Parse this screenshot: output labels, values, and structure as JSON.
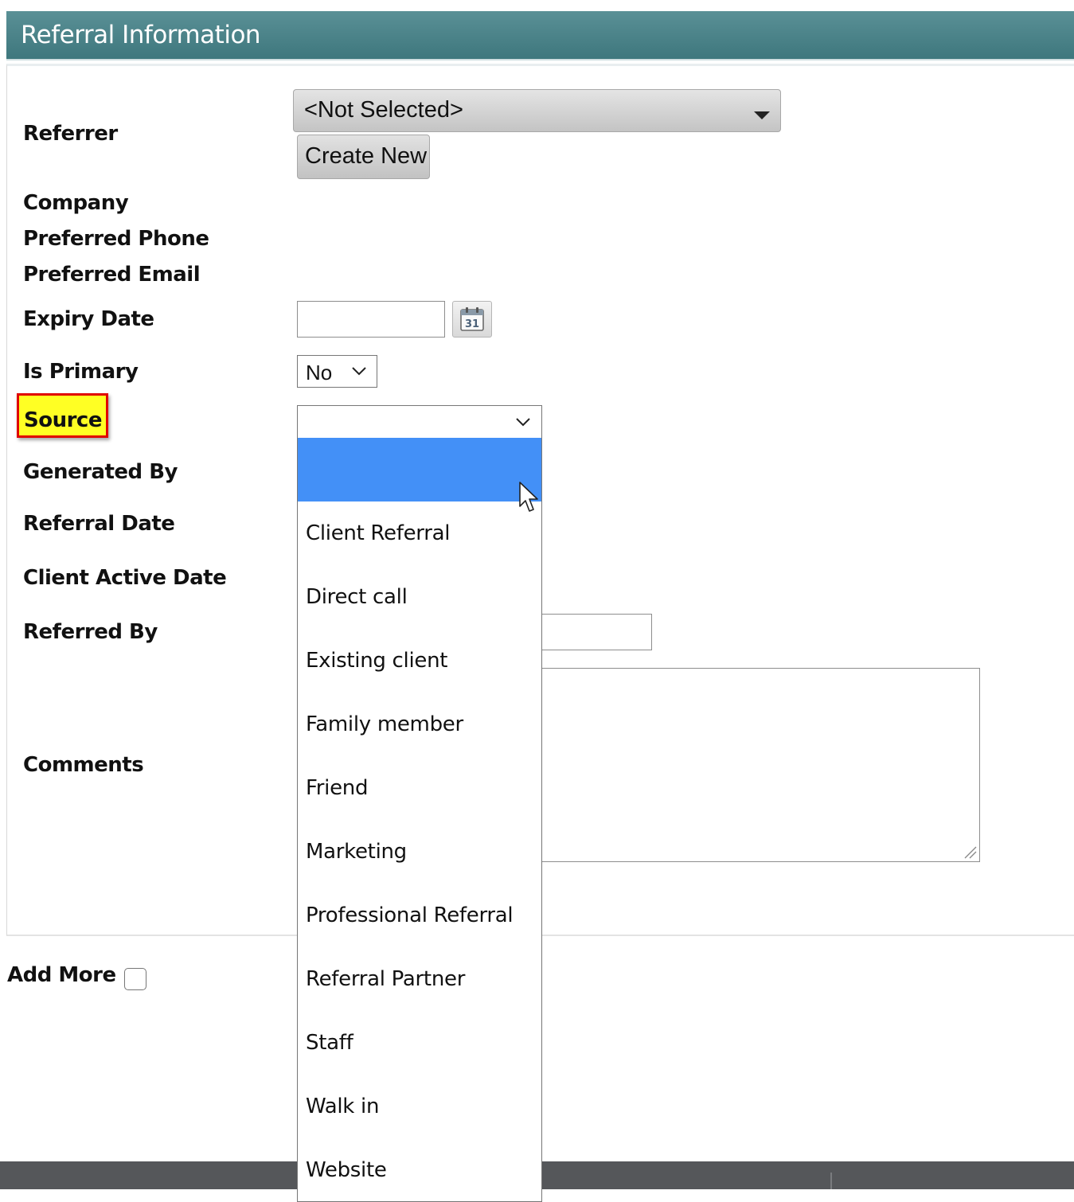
{
  "header": {
    "title": "Referral Information"
  },
  "labels": {
    "referrer": "Referrer",
    "company": "Company",
    "preferred_phone": "Preferred Phone",
    "preferred_email": "Preferred Email",
    "expiry_date": "Expiry Date",
    "is_primary": "Is Primary",
    "source": "Source",
    "generated_by": "Generated By",
    "referral_date": "Referral Date",
    "client_active_date": "Client Active Date",
    "referred_by": "Referred By",
    "comments": "Comments",
    "add_more": "Add More"
  },
  "referrer": {
    "selected": "<Not Selected>",
    "create_new_label": "Create New"
  },
  "expiry_date": {
    "value": ""
  },
  "is_primary": {
    "selected": "No"
  },
  "source": {
    "selected": "",
    "options": [
      "",
      "Client Referral",
      "Direct call",
      "Existing client",
      "Family member",
      "Friend",
      "Marketing",
      "Professional Referral",
      "Referral Partner",
      "Staff",
      "Walk in",
      "Website"
    ]
  },
  "referred_by": {
    "value": ""
  },
  "comments": {
    "value": ""
  },
  "colors": {
    "header": "#4a8389",
    "highlight": "#ffff24",
    "highlight_border": "#e00000",
    "selected_option": "#4390f7",
    "footer": "#55575a"
  }
}
